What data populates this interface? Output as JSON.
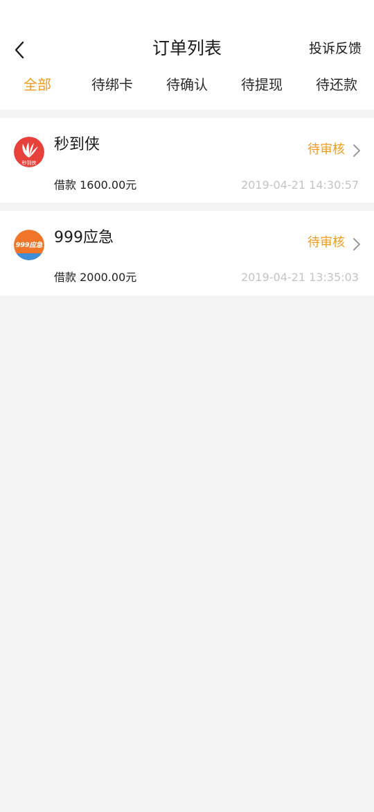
{
  "header": {
    "title": "订单列表",
    "complaint_label": "投诉反馈"
  },
  "tabs": [
    {
      "label": "全部",
      "active": true
    },
    {
      "label": "待绑卡",
      "active": false
    },
    {
      "label": "待确认",
      "active": false
    },
    {
      "label": "待提现",
      "active": false
    },
    {
      "label": "待还款",
      "active": false
    }
  ],
  "orders": [
    {
      "name": "秒到侠",
      "status": "待审核",
      "amount": "借款 1600.00元",
      "time": "2019-04-21 14:30:57",
      "logo_text": "秒到侠",
      "logo_color": "#e8403a"
    },
    {
      "name": "999应急",
      "status": "待审核",
      "amount": "借款 2000.00元",
      "time": "2019-04-21 13:35:03",
      "logo_text": "999应急",
      "logo_color": "#f2762a"
    }
  ],
  "colors": {
    "accent": "#f39a1e",
    "background": "#f3f3f3",
    "timestamp": "#c4c4c4"
  }
}
